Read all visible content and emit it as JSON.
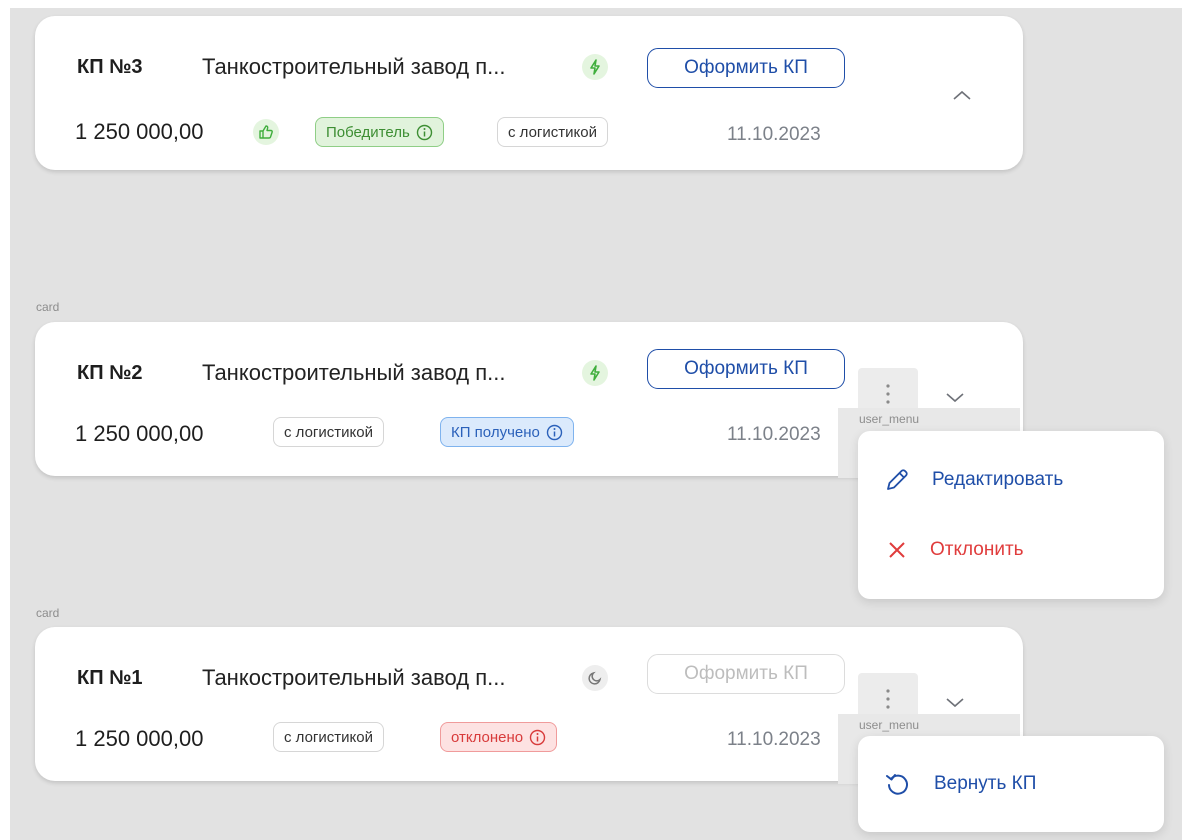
{
  "frame_labels": {
    "card": "card",
    "user_menu": "user_menu"
  },
  "cards": [
    {
      "number": "КП №3",
      "supplier": "Танкостроительный завод п...",
      "status_icon": "lightning-icon",
      "action_label": "Оформить КП",
      "amount": "1 250 000,00",
      "amount_icon": "thumbs-up-icon",
      "tags": [
        "Победитель",
        "с логистикой"
      ],
      "date": "11.10.2023",
      "expanded": true
    },
    {
      "number": "КП №2",
      "supplier": "Танкостроительный завод п...",
      "status_icon": "lightning-icon",
      "action_label": "Оформить КП",
      "amount": "1 250 000,00",
      "tags": [
        "с логистикой",
        "КП получено"
      ],
      "date": "11.10.2023",
      "expanded": false
    },
    {
      "number": "КП №1",
      "supplier": "Танкостроительный завод п...",
      "status_icon": "clock-icon",
      "action_label": "Оформить КП",
      "action_disabled": true,
      "amount": "1 250 000,00",
      "tags": [
        "с логистикой",
        "отклонено"
      ],
      "date": "11.10.2023",
      "expanded": false
    }
  ],
  "menu_card2": {
    "edit_label": "Редактировать",
    "reject_label": "Отклонить"
  },
  "menu_card1": {
    "return_label": "Вернуть КП"
  },
  "colors": {
    "accent": "#1f4ea8",
    "winner_green": "#3d8e33",
    "received_blue": "#2b61ba",
    "rejected_red": "#d83b3b",
    "canvas_bg": "#e2e2e2"
  }
}
